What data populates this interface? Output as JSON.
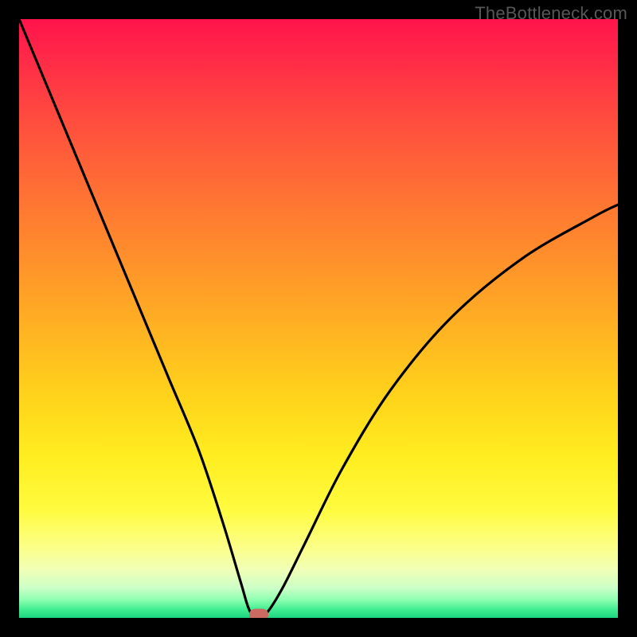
{
  "watermark": "TheBottleneck.com",
  "colors": {
    "background": "#000000",
    "gradient_top": "#ff134b",
    "gradient_bottom": "#1bd580",
    "curve_stroke": "#000000",
    "marker_fill": "#cb6a60"
  },
  "chart_data": {
    "type": "line",
    "title": "",
    "xlabel": "",
    "ylabel": "",
    "xlim": [
      0,
      100
    ],
    "ylim": [
      0,
      100
    ],
    "grid": false,
    "legend": null,
    "curve_description": "V-shaped curve representing bottleneck percentage vs component balance; minimum near x≈40 where bottleneck is ~0%, rising steeply toward high bottleneck on both sides.",
    "series": [
      {
        "name": "bottleneck",
        "x": [
          0,
          5,
          10,
          15,
          20,
          25,
          30,
          34,
          37,
          38.5,
          40,
          41.5,
          44,
          48,
          54,
          62,
          72,
          84,
          96,
          100
        ],
        "values": [
          100,
          88,
          76,
          64,
          52,
          40,
          28,
          16,
          6,
          1.2,
          0,
          1.0,
          5,
          13,
          25,
          38,
          50,
          60,
          67,
          69
        ]
      }
    ],
    "marker": {
      "x": 40,
      "y": 0.5,
      "label": "min-bottleneck-marker"
    }
  }
}
